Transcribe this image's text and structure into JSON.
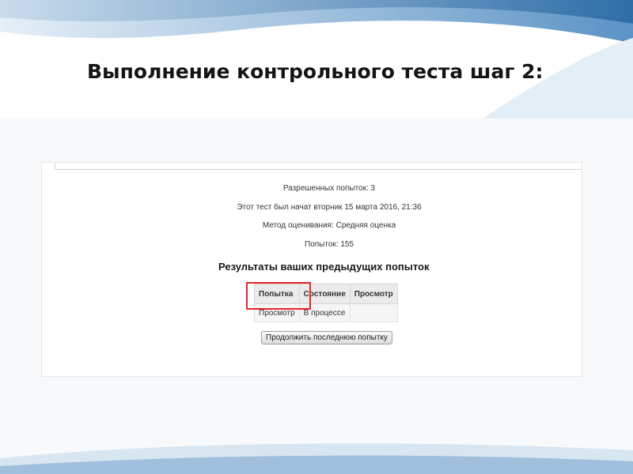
{
  "slide": {
    "title": "Выполнение контрольного теста шаг 2:"
  },
  "quiz_info": {
    "attempts_allowed": "Разрешенных попыток: 3",
    "started": "Этот тест был начат вторник 15 марта 2016, 21:36",
    "grading_method": "Метод оценивания: Средняя оценка",
    "attempts_count": "Попыток: 155"
  },
  "results": {
    "heading": "Результаты ваших предыдущих попыток",
    "columns": [
      "Попытка",
      "Состояние",
      "Просмотр"
    ],
    "rows": [
      [
        "Просмотр",
        "В процессе",
        ""
      ]
    ]
  },
  "continue_button": {
    "label": "Продолжить последнюю попытку"
  },
  "colors": {
    "highlight": "#e8252b",
    "decor_blue": "#2f6ea8"
  }
}
